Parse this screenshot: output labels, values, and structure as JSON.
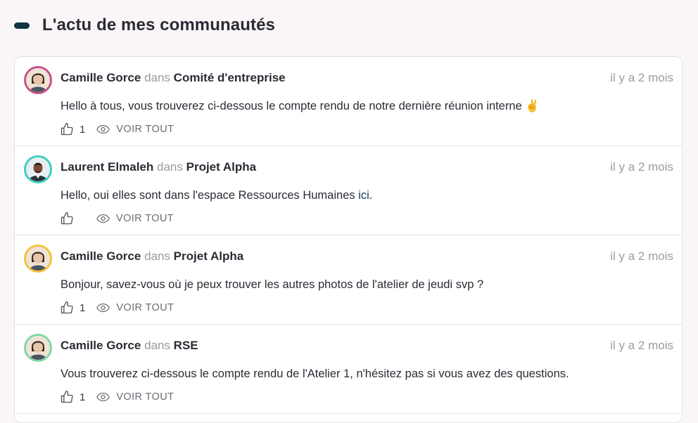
{
  "section": {
    "title": "L'actu de mes communautés"
  },
  "posts": [
    {
      "author": "Camille Gorce",
      "in_word": "dans",
      "community": "Comité d'entreprise",
      "time": "il y a 2 mois",
      "message": "Hello à tous, vous trouverez ci-dessous le compte rendu de notre dernière réunion interne ✌️",
      "likes": "1",
      "view_label": "VOIR TOUT",
      "ring_color": "#c9508a"
    },
    {
      "author": "Laurent Elmaleh",
      "in_word": "dans",
      "community": "Projet Alpha",
      "time": "il y a 2 mois",
      "message_before": "Hello, oui elles sont dans l'espace Ressources Humaines ",
      "message_link": "ici",
      "message_after": ".",
      "likes": "",
      "view_label": "VOIR TOUT",
      "ring_color": "#3ccfc2"
    },
    {
      "author": "Camille Gorce",
      "in_word": "dans",
      "community": "Projet Alpha",
      "time": "il y a 2 mois",
      "message": "Bonjour, savez-vous où je peux trouver les autres photos de l'atelier de jeudi svp ?",
      "likes": "1",
      "view_label": "VOIR TOUT",
      "ring_color": "#f2c43a"
    },
    {
      "author": "Camille Gorce",
      "in_word": "dans",
      "community": "RSE",
      "time": "il y a 2 mois",
      "message": "Vous trouverez ci-dessous le compte rendu de l'Atelier 1, n'hésitez pas si vous avez des questions.",
      "likes": "1",
      "view_label": "VOIR TOUT",
      "ring_color": "#7fd8a6"
    }
  ]
}
